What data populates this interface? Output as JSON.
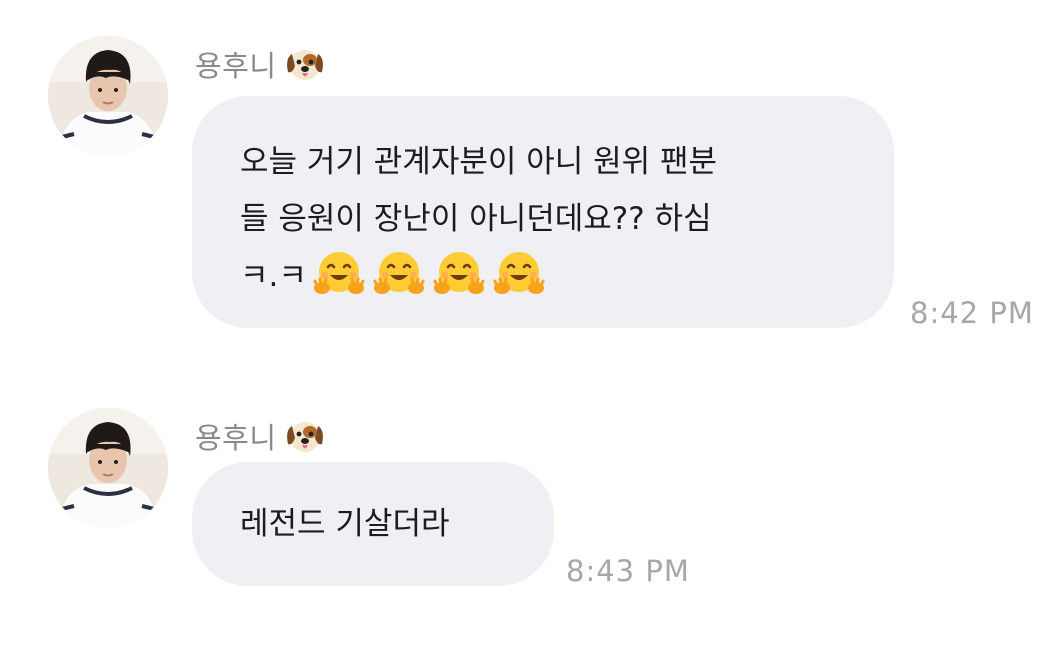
{
  "messages": [
    {
      "sender": "용후니",
      "sender_emoji": "dog-face-icon",
      "lines": [
        "오늘 거기 관계자분이 아니 원위 팬분",
        "들 응원이 장난이 아니던데요?? 하심",
        "ㅋ.ㅋ"
      ],
      "trailing_emojis": [
        "hugging-face-icon",
        "hugging-face-icon",
        "hugging-face-icon",
        "hugging-face-icon"
      ],
      "time": "8:42 PM"
    },
    {
      "sender": "용후니",
      "sender_emoji": "dog-face-icon",
      "lines": [
        "레전드 기살더라"
      ],
      "time": "8:43 PM"
    }
  ],
  "colors": {
    "bubble_bg": "#efeff4",
    "text": "#1c1c1e",
    "meta_text": "#8a8a8e",
    "timestamp": "#a6a6ab"
  }
}
